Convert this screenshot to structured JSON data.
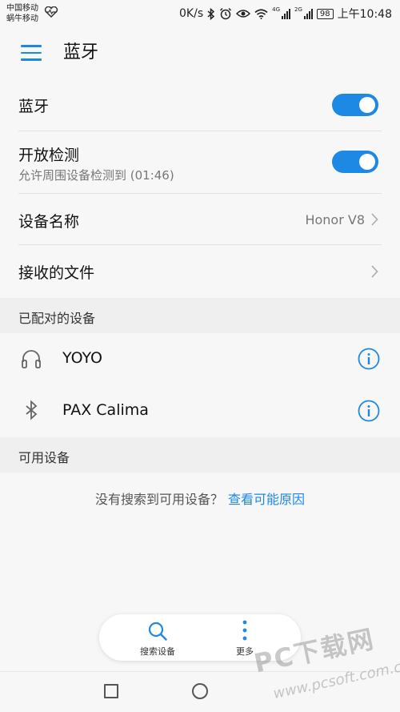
{
  "status_bar": {
    "carrier_1": "中国移动",
    "carrier_2": "蜗牛移动",
    "speed": "0K/s",
    "net_tag_1": "4G",
    "net_tag_2": "2G",
    "battery": "98",
    "time": "上午10:48"
  },
  "toolbar": {
    "title": "蓝牙"
  },
  "settings": {
    "bluetooth_label": "蓝牙",
    "bluetooth_on": true,
    "discovery_label": "开放检测",
    "discovery_sub": "允许周围设备检测到 (01:46)",
    "discovery_on": true,
    "device_name_label": "设备名称",
    "device_name_value": "Honor V8",
    "received_files_label": "接收的文件"
  },
  "paired": {
    "header": "已配对的设备",
    "devices": [
      {
        "name": "YOYO",
        "icon": "headset-icon"
      },
      {
        "name": "PAX Calima",
        "icon": "bluetooth-icon"
      }
    ]
  },
  "available": {
    "header": "可用设备",
    "empty_message": "没有搜索到可用设备？",
    "empty_link": "查看可能原因"
  },
  "bottom_bar": {
    "search_label": "搜索设备",
    "more_label": "更多"
  },
  "watermark": {
    "text": "PC下载网",
    "url": "www.pcsoft.com.cn"
  },
  "colors": {
    "accent": "#1e88e5",
    "background": "#f7f7f7",
    "section_bg": "#efefef"
  }
}
